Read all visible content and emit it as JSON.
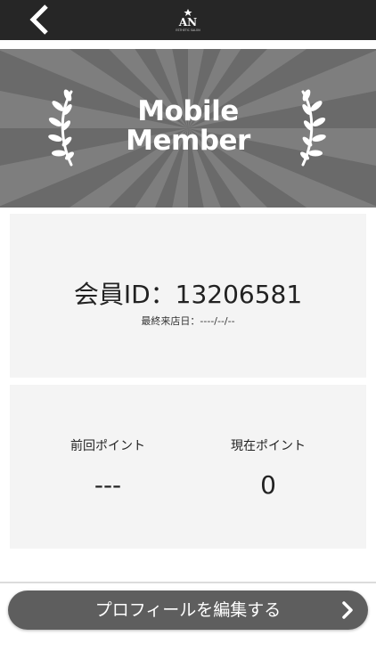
{
  "header": {
    "logo_text": "AN",
    "logo_subtext": "ESTHETIC SALON",
    "icon_back": "chevron-left-icon",
    "icon_logo": "brand-logo"
  },
  "banner": {
    "title_line1": "Mobile",
    "title_line2": "Member",
    "icon_left": "laurel-left-icon",
    "icon_right": "laurel-right-icon",
    "bg_color": "#6a6a6a",
    "ray_color": "#7e7e7e"
  },
  "member": {
    "id_label": "会員ID：",
    "id_value": "13206581",
    "last_visit_label": "最終来店日：",
    "last_visit_value": "----/--/--"
  },
  "points": {
    "previous_label": "前回ポイント",
    "previous_value": "---",
    "current_label": "現在ポイント",
    "current_value": "0"
  },
  "footer": {
    "edit_profile_label": "プロフィールを編集する",
    "icon_chevron": "chevron-right-icon"
  },
  "colors": {
    "header_bg": "#262626",
    "card_bg": "#f4f4f4",
    "button_bg": "#5e5e5e"
  }
}
